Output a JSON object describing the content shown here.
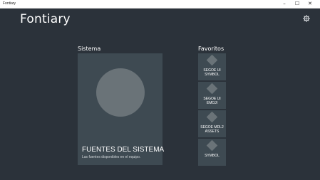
{
  "window": {
    "title": "Fontiary",
    "controls": [
      {
        "name": "minimize",
        "glyph": "–"
      },
      {
        "name": "maximize",
        "glyph": "☐"
      },
      {
        "name": "close",
        "glyph": "✕"
      }
    ]
  },
  "header": {
    "app_title": "Fontiary",
    "settings_icon": "gear-icon"
  },
  "system": {
    "label": "Sistema",
    "tile": {
      "heading": "FUENTES DEL SISTEMA",
      "subtitle": "Las fuentes disponibles en el equipo."
    }
  },
  "favorites": {
    "label": "Favoritos",
    "items": [
      {
        "line1": "SEGOE UI",
        "line2": "SYMBOL"
      },
      {
        "line1": "SEGOE UI",
        "line2": "EMOJI"
      },
      {
        "line1": "SEGOE MDL2",
        "line2": "ASSETS"
      },
      {
        "line1": "SYMBOL",
        "line2": ""
      }
    ]
  },
  "colors": {
    "background": "#2b323a",
    "tile": "#3e4a52",
    "placeholder": "#6a7378"
  }
}
